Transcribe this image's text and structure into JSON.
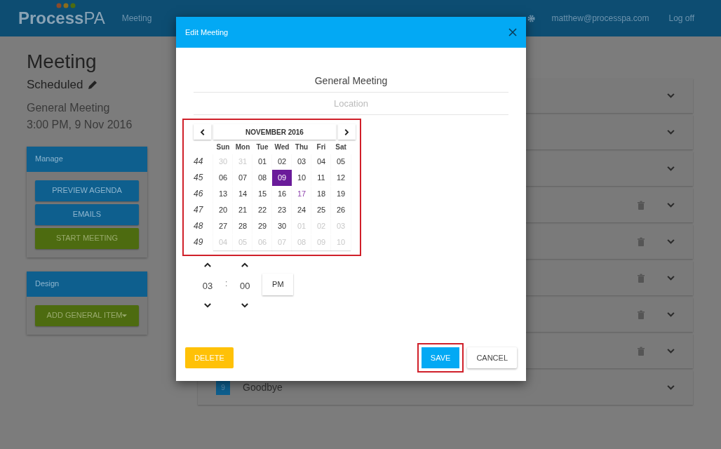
{
  "header": {
    "logo": {
      "main": "Process",
      "accent": "PA"
    },
    "nav": [
      "Meeting"
    ],
    "user": "matthew@processpa.com",
    "logout": "Log off"
  },
  "page": {
    "title": "Meeting",
    "status": "Scheduled",
    "subtitle": "General Meeting",
    "when": "3:00 PM, 9 Nov 2016"
  },
  "panels": [
    {
      "title": "Manage",
      "buttons": [
        {
          "label": "PREVIEW AGENDA",
          "kind": "primary",
          "dropdown": false
        },
        {
          "label": "EMAILS",
          "kind": "primary",
          "dropdown": false
        },
        {
          "label": "START MEETING",
          "kind": "success",
          "dropdown": false
        }
      ]
    },
    {
      "title": "Design",
      "buttons": [
        {
          "label": "ADD GENERAL ITEM",
          "kind": "success",
          "dropdown": true
        }
      ]
    }
  ],
  "agenda": [
    {
      "deletable": false
    },
    {
      "deletable": false
    },
    {
      "deletable": false
    },
    {
      "deletable": true
    },
    {
      "deletable": true
    },
    {
      "deletable": true
    },
    {
      "deletable": true
    },
    {
      "deletable": true
    },
    {
      "number": "9",
      "title": "Goodbye",
      "deletable": false
    }
  ],
  "dialog": {
    "title": "Edit Meeting",
    "name": "General Meeting",
    "location_placeholder": "Location",
    "calendar": {
      "month": "NOVEMBER 2016",
      "weekdays": [
        "Sun",
        "Mon",
        "Tue",
        "Wed",
        "Thu",
        "Fri",
        "Sat"
      ],
      "weeks": [
        {
          "number": "44",
          "days": [
            {
              "label": "30",
              "muted": true,
              "today": false,
              "selected": false
            },
            {
              "label": "31",
              "muted": true,
              "today": false,
              "selected": false
            },
            {
              "label": "01",
              "muted": false,
              "today": false,
              "selected": false
            },
            {
              "label": "02",
              "muted": false,
              "today": false,
              "selected": false
            },
            {
              "label": "03",
              "muted": false,
              "today": false,
              "selected": false
            },
            {
              "label": "04",
              "muted": false,
              "today": false,
              "selected": false
            },
            {
              "label": "05",
              "muted": false,
              "today": false,
              "selected": false
            }
          ]
        },
        {
          "number": "45",
          "days": [
            {
              "label": "06",
              "muted": false,
              "today": false,
              "selected": false
            },
            {
              "label": "07",
              "muted": false,
              "today": false,
              "selected": false
            },
            {
              "label": "08",
              "muted": false,
              "today": false,
              "selected": false
            },
            {
              "label": "09",
              "muted": false,
              "today": false,
              "selected": true
            },
            {
              "label": "10",
              "muted": false,
              "today": false,
              "selected": false
            },
            {
              "label": "11",
              "muted": false,
              "today": false,
              "selected": false
            },
            {
              "label": "12",
              "muted": false,
              "today": false,
              "selected": false
            }
          ]
        },
        {
          "number": "46",
          "days": [
            {
              "label": "13",
              "muted": false,
              "today": false,
              "selected": false
            },
            {
              "label": "14",
              "muted": false,
              "today": false,
              "selected": false
            },
            {
              "label": "15",
              "muted": false,
              "today": false,
              "selected": false
            },
            {
              "label": "16",
              "muted": false,
              "today": false,
              "selected": false
            },
            {
              "label": "17",
              "muted": false,
              "today": true,
              "selected": false
            },
            {
              "label": "18",
              "muted": false,
              "today": false,
              "selected": false
            },
            {
              "label": "19",
              "muted": false,
              "today": false,
              "selected": false
            }
          ]
        },
        {
          "number": "47",
          "days": [
            {
              "label": "20",
              "muted": false,
              "today": false,
              "selected": false
            },
            {
              "label": "21",
              "muted": false,
              "today": false,
              "selected": false
            },
            {
              "label": "22",
              "muted": false,
              "today": false,
              "selected": false
            },
            {
              "label": "23",
              "muted": false,
              "today": false,
              "selected": false
            },
            {
              "label": "24",
              "muted": false,
              "today": false,
              "selected": false
            },
            {
              "label": "25",
              "muted": false,
              "today": false,
              "selected": false
            },
            {
              "label": "26",
              "muted": false,
              "today": false,
              "selected": false
            }
          ]
        },
        {
          "number": "48",
          "days": [
            {
              "label": "27",
              "muted": false,
              "today": false,
              "selected": false
            },
            {
              "label": "28",
              "muted": false,
              "today": false,
              "selected": false
            },
            {
              "label": "29",
              "muted": false,
              "today": false,
              "selected": false
            },
            {
              "label": "30",
              "muted": false,
              "today": false,
              "selected": false
            },
            {
              "label": "01",
              "muted": true,
              "today": false,
              "selected": false
            },
            {
              "label": "02",
              "muted": true,
              "today": false,
              "selected": false
            },
            {
              "label": "03",
              "muted": true,
              "today": false,
              "selected": false
            }
          ]
        },
        {
          "number": "49",
          "days": [
            {
              "label": "04",
              "muted": true,
              "today": false,
              "selected": false
            },
            {
              "label": "05",
              "muted": true,
              "today": false,
              "selected": false
            },
            {
              "label": "06",
              "muted": true,
              "today": false,
              "selected": false
            },
            {
              "label": "07",
              "muted": true,
              "today": false,
              "selected": false
            },
            {
              "label": "08",
              "muted": true,
              "today": false,
              "selected": false
            },
            {
              "label": "09",
              "muted": true,
              "today": false,
              "selected": false
            },
            {
              "label": "10",
              "muted": true,
              "today": false,
              "selected": false
            }
          ]
        }
      ]
    },
    "time": {
      "hours": "03",
      "separator": ":",
      "minutes": "00",
      "meridian": "PM"
    },
    "buttons": [
      {
        "label": "DELETE",
        "kind": "warning",
        "highlighted": false
      },
      {
        "label": "SAVE",
        "kind": "primary",
        "highlighted": true
      },
      {
        "label": "CANCEL",
        "kind": "default",
        "highlighted": false
      }
    ]
  }
}
